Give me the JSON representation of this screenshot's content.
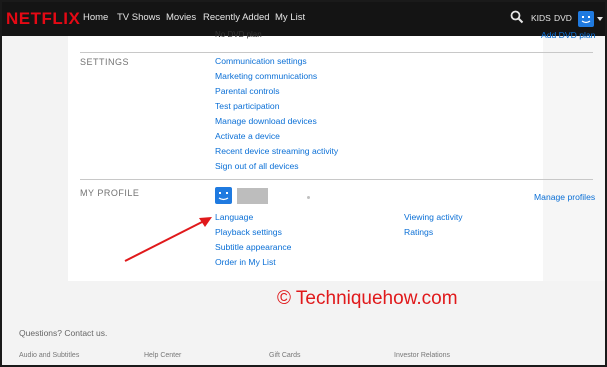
{
  "header": {
    "logo": "NETFLIX",
    "nav": [
      "Home",
      "TV Shows",
      "Movies",
      "Recently Added",
      "My List"
    ],
    "kids_label": "KIDS",
    "dvd_label": "DVD"
  },
  "truncated_row": {
    "left_text": "No DVD plan",
    "right_link": "Add DVD plan"
  },
  "settings": {
    "title": "SETTINGS",
    "links": [
      "Communication settings",
      "Marketing communications",
      "Parental controls",
      "Test participation",
      "Manage download devices",
      "Activate a device",
      "Recent device streaming activity",
      "Sign out of all devices"
    ]
  },
  "my_profile": {
    "title": "MY PROFILE",
    "manage_profiles": "Manage profiles",
    "left_links": [
      "Language",
      "Playback settings",
      "Subtitle appearance",
      "Order in My List"
    ],
    "right_links": [
      "Viewing activity",
      "Ratings"
    ]
  },
  "watermark": "© Techniquehow.com",
  "footer": {
    "question": "Questions? Contact us.",
    "links": [
      "Audio and Subtitles",
      "Help Center",
      "Gift Cards",
      "Investor Relations"
    ]
  },
  "colors": {
    "brand_red": "#e50914",
    "link_blue": "#0a6fd6",
    "arrow_red": "#e0191b"
  }
}
